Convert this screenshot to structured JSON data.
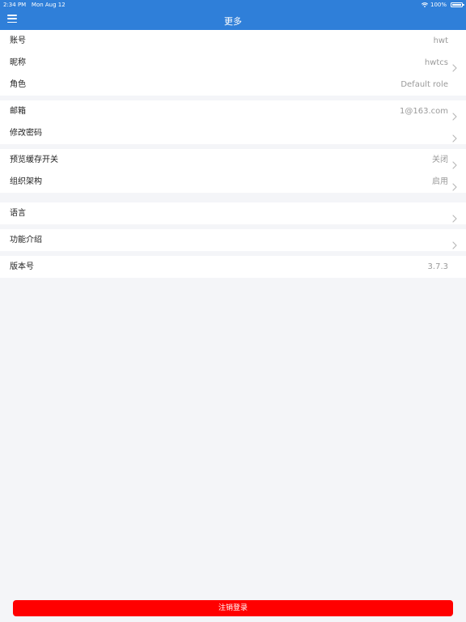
{
  "status_bar": {
    "time": "2:34 PM",
    "date": "Mon Aug 12",
    "battery": "100%",
    "battery_level": 1.0
  },
  "header": {
    "title": "更多",
    "menu_icon": "hamburger-icon"
  },
  "groups": [
    {
      "rows": [
        {
          "label": "账号",
          "value": "hwt",
          "chevron": false
        },
        {
          "label": "昵称",
          "value": "hwtcs",
          "chevron": true
        },
        {
          "label": "角色",
          "value": "Default role",
          "chevron": false
        }
      ]
    },
    {
      "rows": [
        {
          "label": "邮箱",
          "value": "1@163.com",
          "chevron": true
        },
        {
          "label": "修改密码",
          "value": "",
          "chevron": true
        }
      ]
    },
    {
      "rows": [
        {
          "label": "预览缓存开关",
          "value": "关闭",
          "chevron": true
        },
        {
          "label": "组织架构",
          "value": "启用",
          "chevron": true
        }
      ]
    },
    {
      "rows": [
        {
          "label": "语言",
          "value": "",
          "chevron": true
        }
      ]
    },
    {
      "rows": [
        {
          "label": "功能介绍",
          "value": "",
          "chevron": true
        }
      ]
    },
    {
      "rows": [
        {
          "label": "版本号",
          "value": "3.7.3",
          "chevron": false
        }
      ]
    }
  ],
  "logout_button": {
    "label": "注销登录"
  },
  "colors": {
    "header": "#2f7fd9",
    "background": "#f4f5f8",
    "logout": "#ff0000",
    "value_text": "#9a9a9a"
  }
}
